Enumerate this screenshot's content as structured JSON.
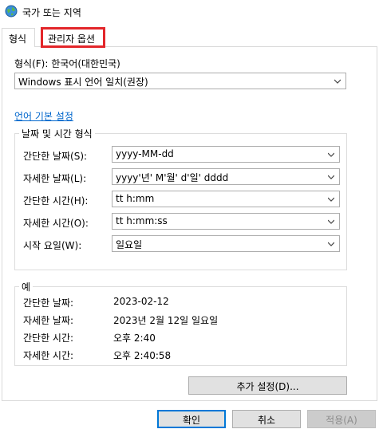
{
  "window": {
    "title": "국가 또는 지역",
    "icon": "globe-icon"
  },
  "tabs": [
    {
      "label": "형식",
      "selected": true
    },
    {
      "label": "관리자 옵션",
      "selected": false,
      "highlight_color": "#e3262a"
    }
  ],
  "format": {
    "label": "형식(F): 한국어(대한민국)",
    "value": "Windows 표시 언어 일치(권장)"
  },
  "language_link": "언어 기본 설정",
  "date_time_group": {
    "title": "날짜 및 시간 형식",
    "rows": [
      {
        "label": "간단한 날짜(S):",
        "value": "yyyy-MM-dd"
      },
      {
        "label": "자세한 날짜(L):",
        "value": "yyyy'년' M'월' d'일' dddd"
      },
      {
        "label": "간단한 시간(H):",
        "value": "tt h:mm"
      },
      {
        "label": "자세한 시간(O):",
        "value": "tt h:mm:ss"
      },
      {
        "label": "시작 요일(W):",
        "value": "일요일"
      }
    ]
  },
  "example_group": {
    "title": "예",
    "rows": [
      {
        "label": "간단한 날짜:",
        "value": "2023-02-12"
      },
      {
        "label": "자세한 날짜:",
        "value": "2023년 2월 12일 일요일"
      },
      {
        "label": "간단한 시간:",
        "value": "오후 2:40"
      },
      {
        "label": "자세한 시간:",
        "value": "오후 2:40:58"
      }
    ]
  },
  "additional_settings_button": "추가 설정(D)...",
  "footer": {
    "ok": "확인",
    "cancel": "취소",
    "apply": "적용(A)"
  },
  "colors": {
    "accent": "#0078d7",
    "link": "#0066cc",
    "highlight": "#e3262a"
  }
}
